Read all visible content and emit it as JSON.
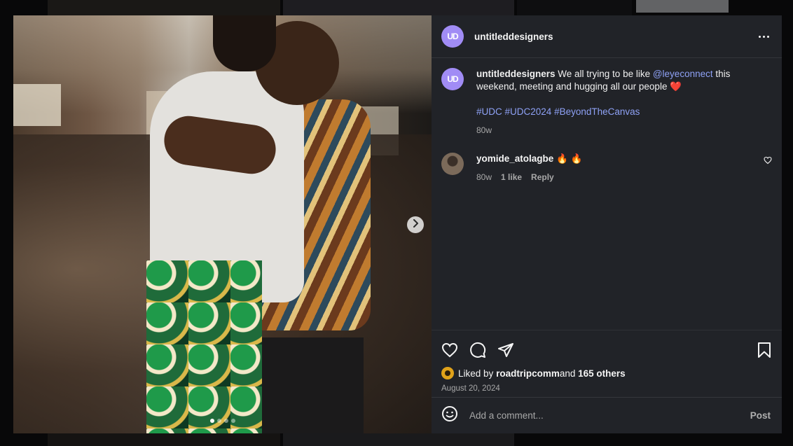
{
  "post": {
    "author": "untitleddesigners",
    "author_avatar_initials": "UD",
    "caption": {
      "author": "untitleddesigners",
      "text_before": "We all trying to be like ",
      "mention": "@leyeconnect",
      "text_after": " this weekend, meeting and hugging all our people ",
      "emoji": "❤️",
      "hashtags": [
        "#UDC",
        "#UDC2024",
        "#BeyondTheCanvas"
      ],
      "age": "80w"
    },
    "comments": [
      {
        "author": "yomide_atolagbe",
        "text": "🔥 🔥",
        "age": "80w",
        "likes": "1 like",
        "reply_label": "Reply"
      }
    ],
    "likes": {
      "prefix": "Liked by ",
      "liker": "roadtripcomm",
      "middle": " and ",
      "others": "165 others"
    },
    "date": "August 20, 2024",
    "carousel": {
      "slides": 4,
      "current": 1
    }
  },
  "composer": {
    "placeholder": "Add a comment...",
    "post_label": "Post"
  },
  "icons": {
    "more": "more-horizontal-icon",
    "next": "chevron-right-icon",
    "like": "heart-icon",
    "comment": "comment-bubble-icon",
    "share": "paper-plane-icon",
    "save": "bookmark-icon",
    "emoji": "smiley-icon"
  },
  "colors": {
    "panel": "#212328",
    "link": "#8ea1f5",
    "avatar_brand": "#a18cf5",
    "text": "#f5f5f5",
    "muted": "#a8a8a8"
  }
}
